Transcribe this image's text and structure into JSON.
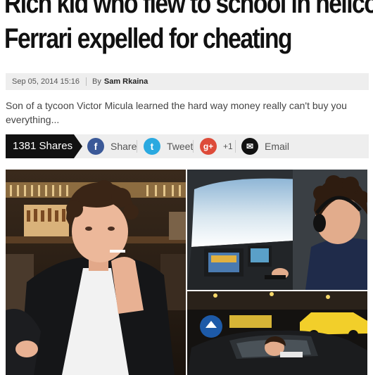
{
  "headline": {
    "line1": "Rich kid who flew to school in helico",
    "line2": "Ferrari expelled for cheating"
  },
  "meta": {
    "date": "Sep 05, 2014 15:16",
    "by_label": "By",
    "author": "Sam Rkaina"
  },
  "summary": "Son of a tycoon Victor Micula learned the hard way money really can't buy you everything...",
  "share_bar": {
    "count_label": "1381 Shares",
    "buttons": [
      {
        "label": "Share",
        "icon": "facebook-icon",
        "glyph": "f",
        "color": "#3b5998"
      },
      {
        "label": "Tweet",
        "icon": "twitter-icon",
        "glyph": "t",
        "color": "#2aa9e0"
      },
      {
        "label": "+1",
        "icon": "google-plus-icon",
        "glyph": "g+",
        "color": "#dd4b39"
      },
      {
        "label": "Email",
        "icon": "email-icon",
        "glyph": "✉",
        "color": "#111111"
      }
    ]
  },
  "photos": [
    {
      "name": "photo-boy-smoking"
    },
    {
      "name": "photo-boy-cockpit"
    },
    {
      "name": "photo-boy-ferrari"
    }
  ]
}
